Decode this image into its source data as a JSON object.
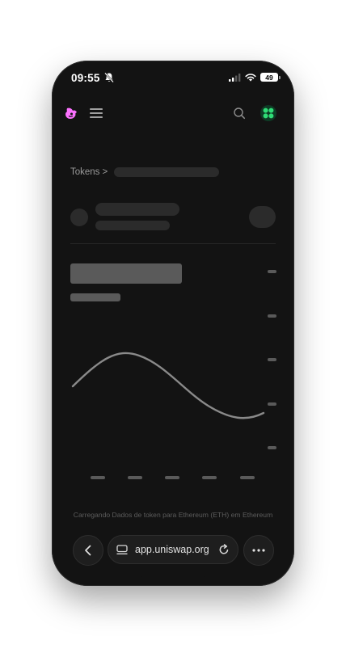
{
  "status_bar": {
    "time": "09:55",
    "battery": "49",
    "icons": [
      "bell-slash-icon",
      "signal-icon",
      "wifi-icon",
      "battery-icon"
    ]
  },
  "header": {
    "icons": [
      "uniswap-logo-icon",
      "hamburger-menu-icon",
      "search-icon",
      "wallet-avatar-icon"
    ],
    "colors": {
      "brand": "#fc72ff",
      "wallet": "#2fdc76"
    }
  },
  "breadcrumb": {
    "root": "Tokens",
    "separator": ">"
  },
  "loading_message": "Carregando Dados de token para Ethereum (ETH) em Ethereum",
  "browser": {
    "url": "app.uniswap.org",
    "icons": [
      "back-chevron-icon",
      "site-settings-icon",
      "reload-icon",
      "more-dots-icon"
    ]
  },
  "colors": {
    "background": "#131313",
    "skeleton": "#2b2b2b",
    "skeleton_bright": "#5a5a5a",
    "curve": "#8a8a8a"
  }
}
